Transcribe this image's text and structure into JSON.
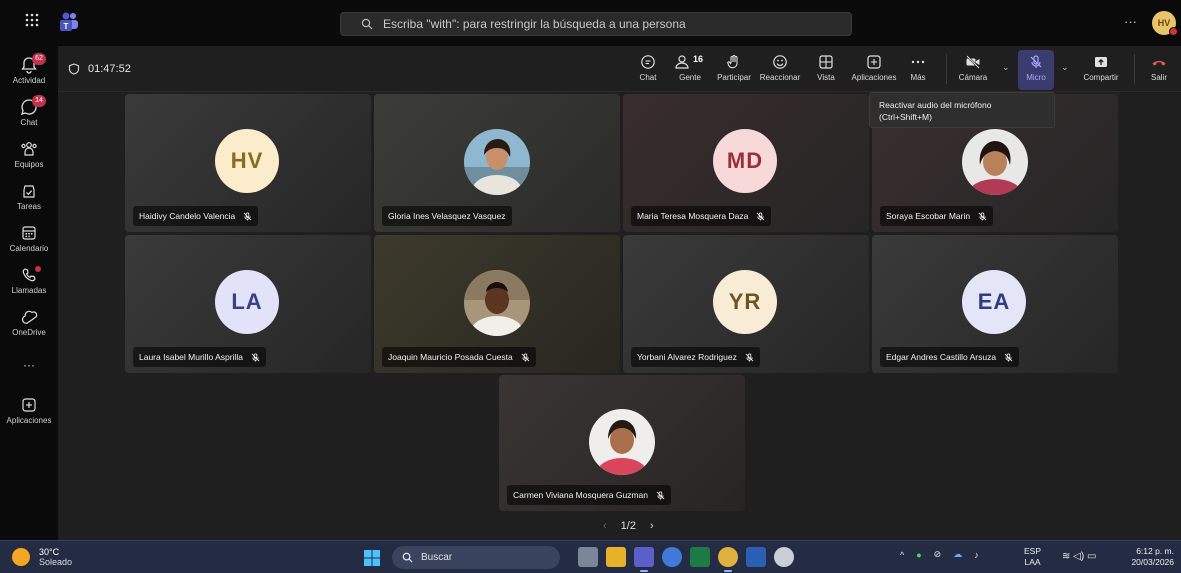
{
  "topbar": {
    "search_placeholder": "Escriba \"with\": para restringir la búsqueda a una persona",
    "more_label": "···",
    "user_initials": "HV"
  },
  "rail": {
    "items": [
      {
        "label": "Actividad",
        "icon": "bell-icon",
        "badge": "62"
      },
      {
        "label": "Chat",
        "icon": "chat-icon",
        "badge": "14"
      },
      {
        "label": "Equipos",
        "icon": "teams-icon",
        "badge": ""
      },
      {
        "label": "Tareas",
        "icon": "tasks-icon",
        "badge": ""
      },
      {
        "label": "Calendario",
        "icon": "calendar-icon",
        "badge": ""
      },
      {
        "label": "Llamadas",
        "icon": "phone-icon",
        "badge": ""
      },
      {
        "label": "OneDrive",
        "icon": "onedrive-icon",
        "badge": ""
      },
      {
        "label": "···",
        "icon": "more-icon",
        "badge": ""
      },
      {
        "label": "Aplicaciones",
        "icon": "apps-add-icon",
        "badge": ""
      }
    ]
  },
  "meeting": {
    "timer": "01:47:52",
    "toolbar": {
      "chat": "Chat",
      "people": "Gente",
      "people_count": "16",
      "raise": "Participar",
      "react": "Reaccionar",
      "view": "Vista",
      "apps": "Aplicaciones",
      "more": "Más",
      "camera": "Cámara",
      "mic": "Micro",
      "share": "Compartir",
      "leave": "Salir"
    },
    "tooltip_line1": "Reactivar audio del micrófono",
    "tooltip_line2": "(Ctrl+Shift+M)",
    "pager": "1/2"
  },
  "participants": [
    {
      "name": "Haidivy Candelo Valencia",
      "initials": "HV",
      "muted": true,
      "avatar_color": "#fbeccb",
      "text_color": "#8a6a1c"
    },
    {
      "name": "Gloria Ines Velasquez Vasquez",
      "initials": "",
      "muted": false,
      "photo": true
    },
    {
      "name": "Maria Teresa Mosquera Daza",
      "initials": "MD",
      "muted": true,
      "avatar_color": "#f8d9d9",
      "text_color": "#9b2f3a"
    },
    {
      "name": "Soraya Escobar Marin",
      "initials": "",
      "muted": true,
      "photo": true
    },
    {
      "name": "Laura Isabel Murillo Asprilla",
      "initials": "LA",
      "muted": true,
      "avatar_color": "#e2e2f8",
      "text_color": "#3b3f8a"
    },
    {
      "name": "Joaquin Mauricio Posada Cuesta",
      "initials": "",
      "muted": true,
      "photo": true
    },
    {
      "name": "Yorbani Alvarez Rodriguez",
      "initials": "YR",
      "muted": true,
      "avatar_color": "#f9ecd6",
      "text_color": "#6f5420"
    },
    {
      "name": "Edgar Andres Castillo Arsuza",
      "initials": "EA",
      "muted": true,
      "avatar_color": "#e4e6f7",
      "text_color": "#2f3c82"
    },
    {
      "name": "Carmen Viviana Mosquera Guzman",
      "initials": "",
      "muted": true,
      "photo": true
    }
  ],
  "taskbar": {
    "temp": "30°C",
    "condition": "Soleado",
    "search": "Buscar",
    "lang1": "ESP",
    "lang2": "LAA",
    "time": "6:12 p. m.",
    "date": "20/03/2026"
  }
}
